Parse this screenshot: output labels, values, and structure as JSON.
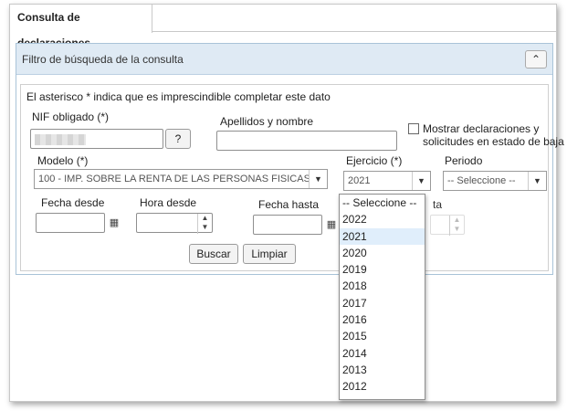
{
  "tab": {
    "label": "Consulta de declaraciones"
  },
  "panel": {
    "title": "Filtro de búsqueda de la consulta",
    "collapse_icon": "chevron-up-icon"
  },
  "form": {
    "note": "El asterisco * indica que es imprescindible completar este dato",
    "nif_label": "NIF obligado (*)",
    "nif_help_label": "?",
    "apellidos_label": "Apellidos y nombre",
    "mostrar_baja_label_line1": "Mostrar declaraciones y",
    "mostrar_baja_label_line2": "solicitudes en estado de baja",
    "modelo_label": "Modelo (*)",
    "modelo_value": "100 - IMP. SOBRE LA RENTA DE LAS PERSONAS FISICAS",
    "ejercicio_label": "Ejercicio (*)",
    "ejercicio_value": "2021",
    "periodo_label": "Periodo",
    "periodo_value": "-- Seleccione --",
    "fecha_desde_label": "Fecha desde",
    "hora_desde_label": "Hora desde",
    "fecha_hasta_label": "Fecha hasta",
    "hora_hasta_partial": "ta",
    "buscar_label": "Buscar",
    "limpiar_label": "Limpiar"
  },
  "ejercicio_options": [
    "-- Seleccione --",
    "2022",
    "2021",
    "2020",
    "2019",
    "2018",
    "2017",
    "2016",
    "2015",
    "2014",
    "2013",
    "2012"
  ],
  "selected_option": "2021",
  "colors": {
    "panel_header_bg": "#dfeaf4",
    "panel_border": "#a9c3d8",
    "option_highlight": "#e0eefb"
  }
}
